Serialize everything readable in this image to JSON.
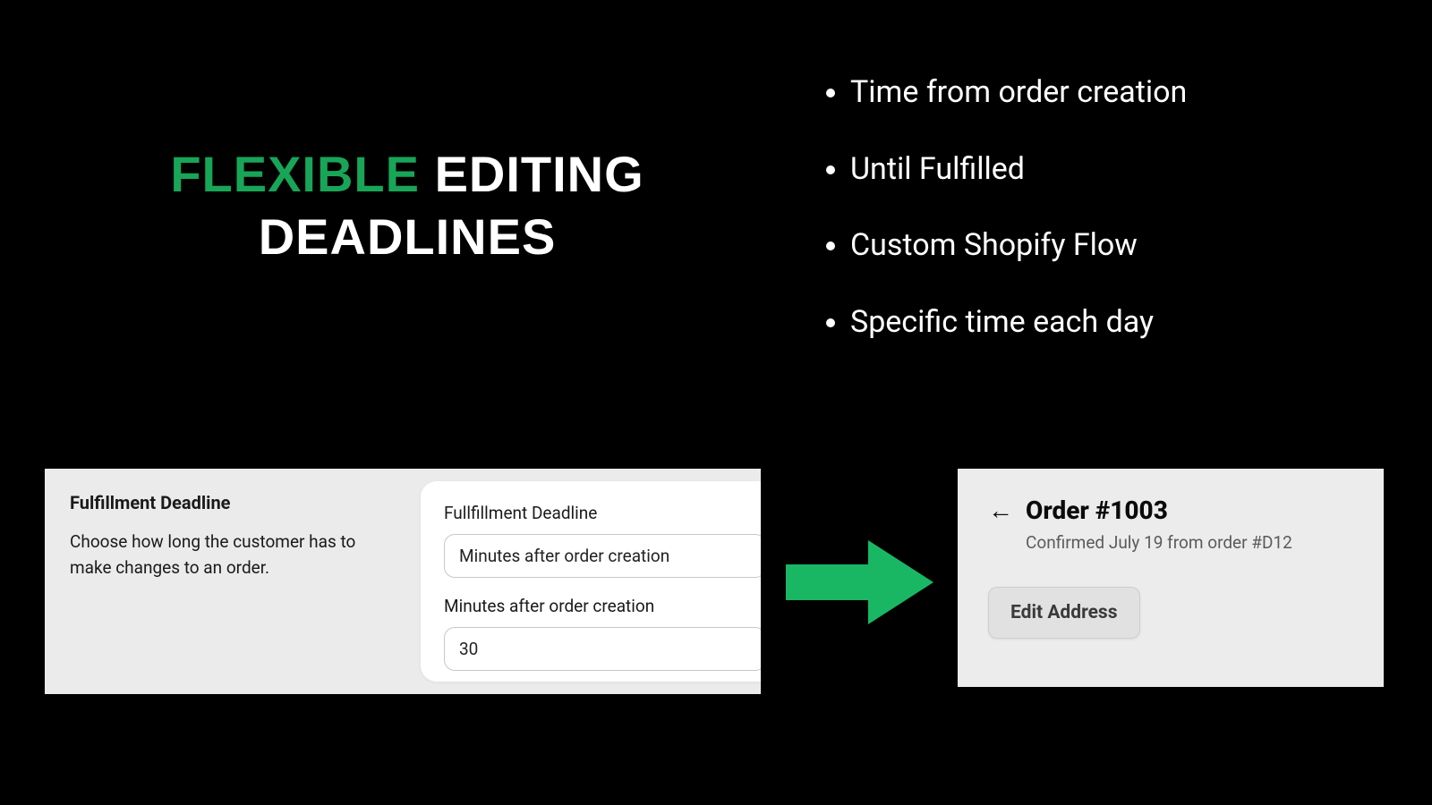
{
  "colors": {
    "accent": "#18a558"
  },
  "headline": {
    "word1": "FLEXIBLE",
    "word2": "EDITING",
    "word3": "DEADLINES"
  },
  "bullets": [
    "Time from order creation",
    "Until Fulfilled",
    "Custom Shopify Flow",
    "Specific time each day"
  ],
  "settings": {
    "section_title": "Fulfillment Deadline",
    "section_desc": "Choose how long the customer has to make changes to an order.",
    "field1_label": "Fullfillment Deadline",
    "field1_value": "Minutes after order creation",
    "field2_label": "Minutes after order creation",
    "field2_value": "30"
  },
  "order": {
    "title": "Order #1003",
    "subtitle": "Confirmed July 19 from order #D12",
    "edit_button": "Edit Address"
  }
}
